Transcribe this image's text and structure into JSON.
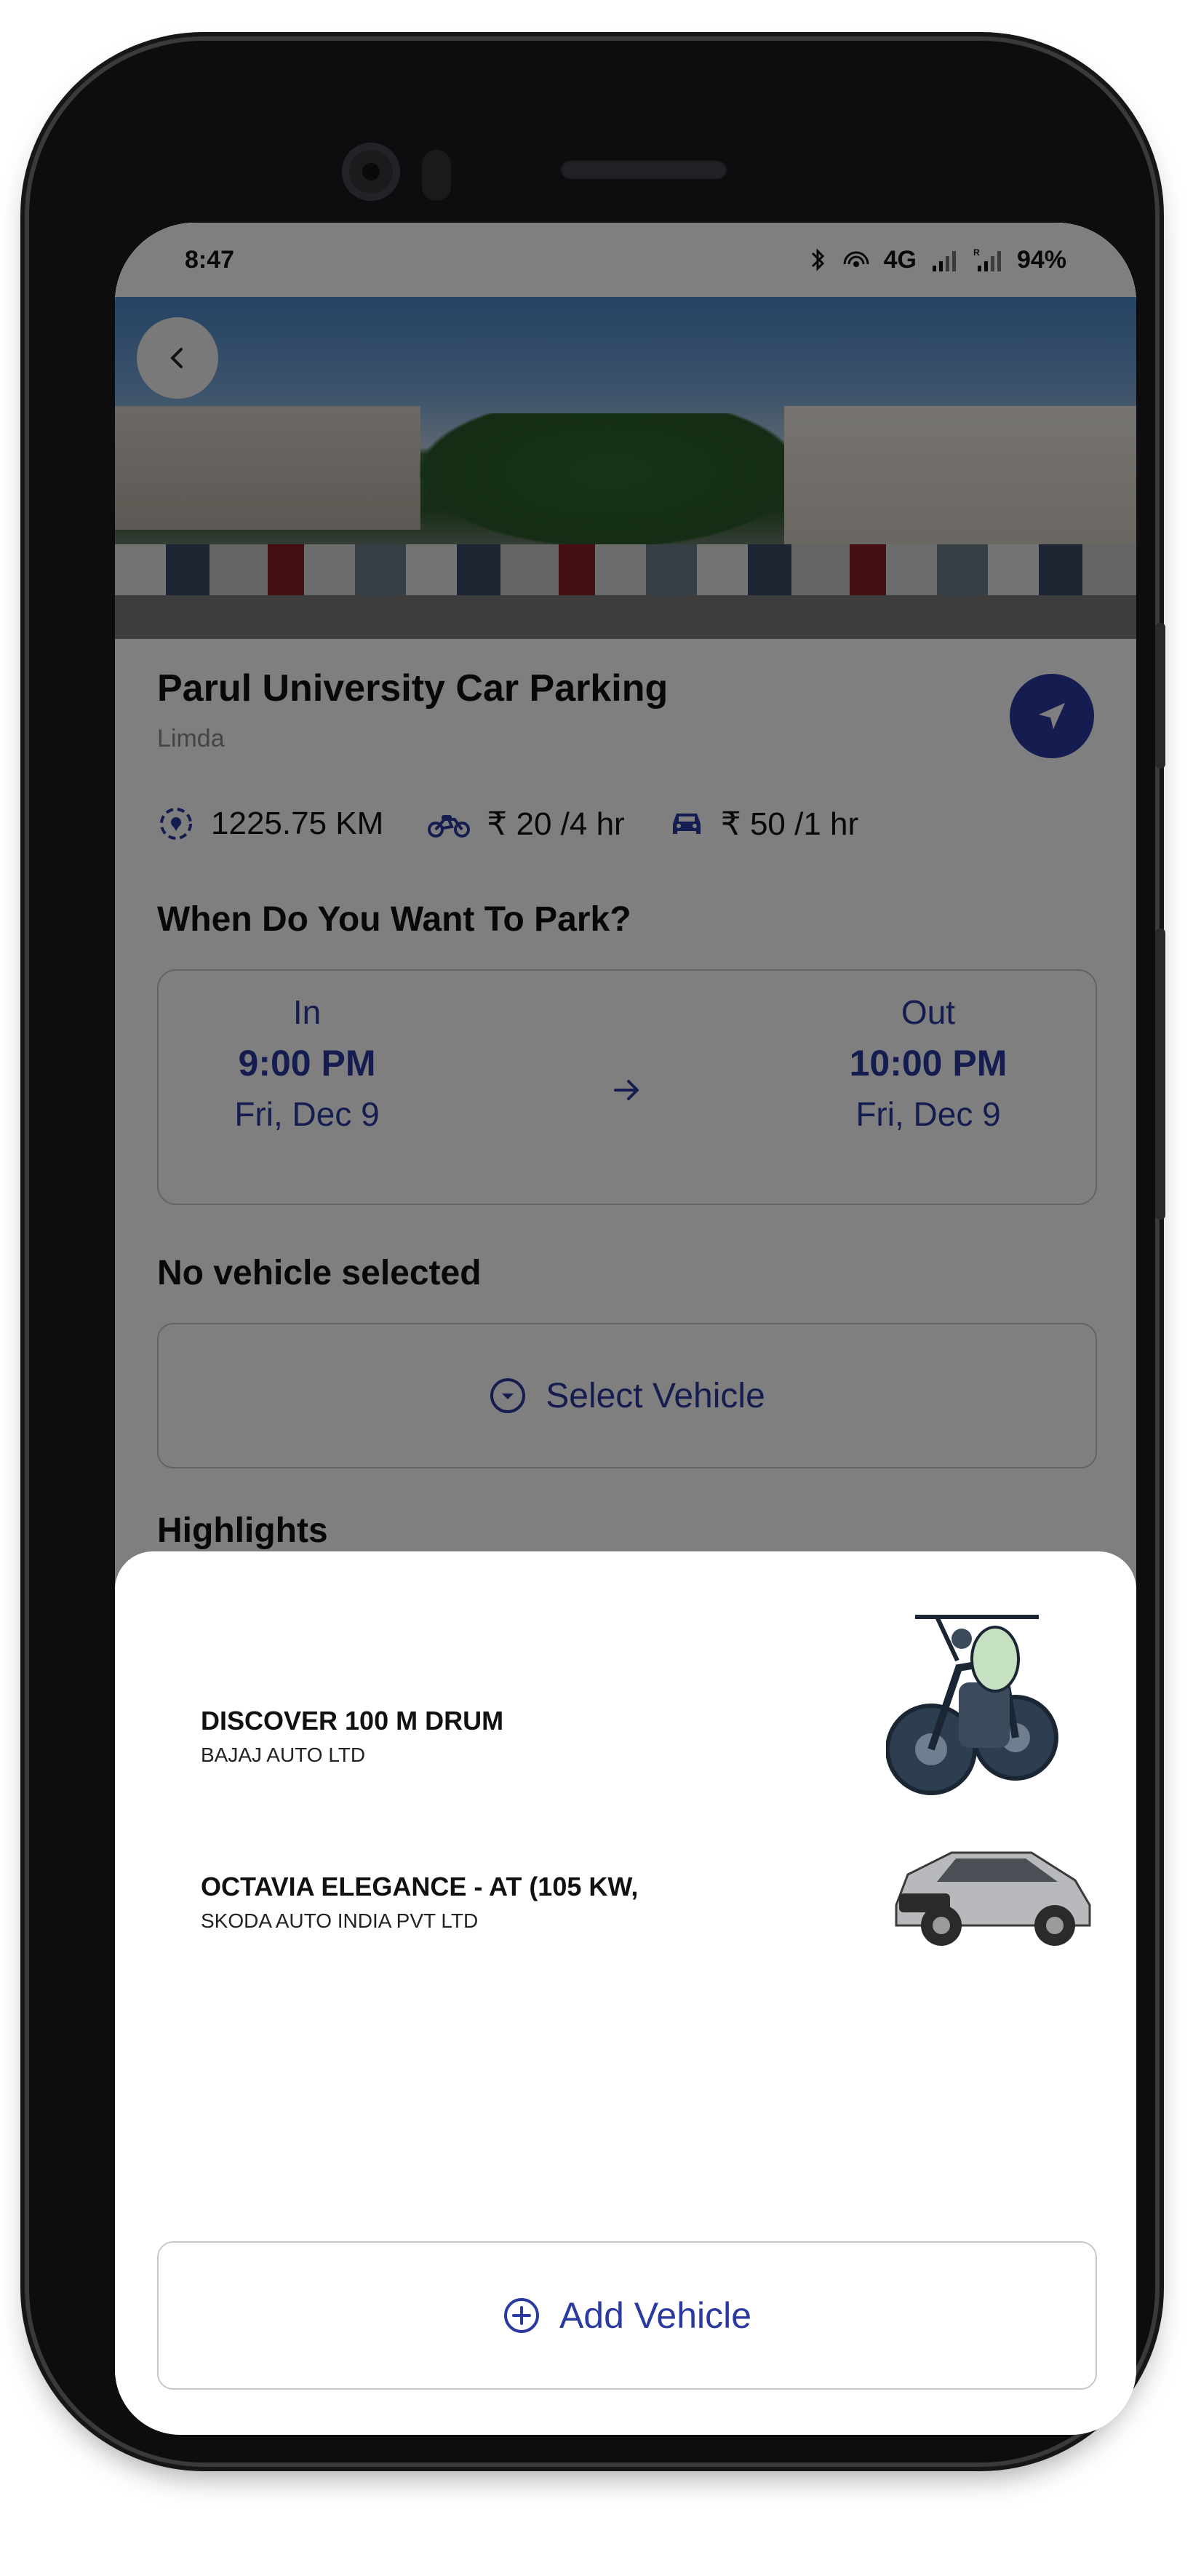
{
  "status_bar": {
    "time": "8:47",
    "network": "4G",
    "battery": "94%"
  },
  "parking": {
    "name": "Parul University Car Parking",
    "location": "Limda",
    "distance": "1225.75 KM",
    "bike_rate": "₹ 20 /4 hr",
    "car_rate": "₹ 50 /1 hr"
  },
  "booking": {
    "section_title": "When Do You Want To Park?",
    "in": {
      "label": "In",
      "time": "9:00 PM",
      "date": "Fri, Dec 9"
    },
    "out": {
      "label": "Out",
      "time": "10:00 PM",
      "date": "Fri, Dec 9"
    }
  },
  "vehicle_section": {
    "title": "No vehicle selected",
    "select_label": "Select Vehicle"
  },
  "highlights_title": "Highlights",
  "sheet": {
    "vehicles": [
      {
        "name": "DISCOVER 100 M DRUM",
        "maker": "BAJAJ AUTO LTD",
        "type_icon": "motorcycle-image"
      },
      {
        "name": "OCTAVIA ELEGANCE - AT (105 KW,",
        "maker": "SKODA AUTO INDIA PVT LTD",
        "type_icon": "car-image"
      }
    ],
    "add_label": "Add Vehicle"
  },
  "colors": {
    "accent": "#2b3aa0",
    "overlay": "rgba(0,0,0,0.5)",
    "border": "#c8c8c8"
  }
}
